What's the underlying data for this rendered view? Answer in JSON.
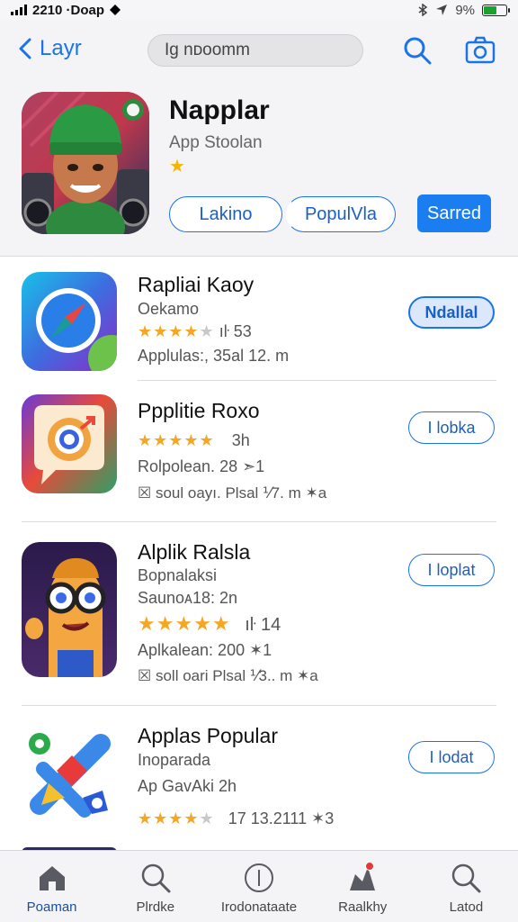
{
  "status_bar": {
    "time": "2210 ·Doap",
    "battery_text": "9%",
    "battery_level": 0.6
  },
  "header": {
    "back_label": "Layr",
    "search_text": "Ig nᴅoomm",
    "icons": [
      "search-icon",
      "camera-icon"
    ]
  },
  "featured": {
    "title": "Napplar",
    "subtitle": "App Stoolan",
    "star": "★",
    "chips": [
      "Lakino",
      "PopulVla"
    ],
    "primary_label": "Sarred"
  },
  "apps": [
    {
      "title": "Rapliai Kaoy",
      "line1": "Oekamo",
      "stars": 4,
      "rating_tail": "ıŀ  53",
      "line3": "Applulas:, 35al 12. m",
      "line4": "",
      "button": "Ndallal",
      "button_active": true
    },
    {
      "title": "Ppplitie Roxo",
      "line1": "",
      "stars": 5,
      "rating_tail": "3h",
      "line3": "Rolpolean. 28   ➣1",
      "line4": "☒ soul oayı. Plsal ⅟7. m  ✶a",
      "button": "I lobka",
      "button_active": false
    },
    {
      "title": "Alplik Ralsla",
      "line1": "Bopnalaksi",
      "line2": "Saunoᴀ18:  2n",
      "stars": 5,
      "rating_tail": "ıŀ  14",
      "line3": "Aplkalean: 200  ✶1",
      "line4": "☒ soll oari Plsal ⅟3.. m  ✶a",
      "button": "I loplat",
      "button_active": false
    },
    {
      "title": "Applas Popular",
      "line1": "Inoparada",
      "line2": "Ap GavAki  2h",
      "stars": 4,
      "rating_tail": "17  13.2111  ✶3",
      "line3": "",
      "line4": "",
      "button": "I lodat",
      "button_active": false
    }
  ],
  "tabs": [
    {
      "label": "Poaman",
      "icon": "home-icon"
    },
    {
      "label": "Plrdke",
      "icon": "search-icon"
    },
    {
      "label": "Irodonataate",
      "icon": "add-circle-icon"
    },
    {
      "label": "Raalkhy",
      "icon": "ranking-icon"
    },
    {
      "label": "Latod",
      "icon": "search-icon"
    }
  ],
  "colors": {
    "accent": "#1a73e8",
    "primary_button": "#1a7ef0",
    "star": "#f5a623",
    "badge": "#e53935"
  }
}
